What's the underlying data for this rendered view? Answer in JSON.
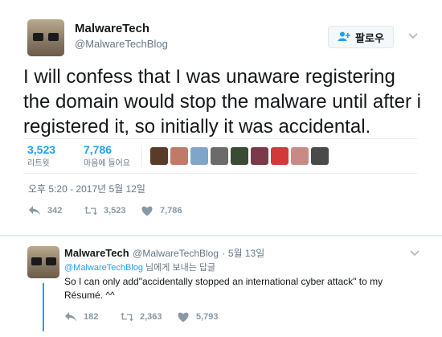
{
  "tweet": {
    "author_name": "MalwareTech",
    "author_handle": "@MalwareTechBlog",
    "follow_label": "팔로우",
    "text": "I will confess that I was unaware registering the domain would stop the malware until after i registered it, so initially it was accidental.",
    "retweets_count": "3,523",
    "retweets_label": "리트윗",
    "likes_count": "7,786",
    "likes_label": "마음에 들어요",
    "timestamp": "오후 5:20 - 2017년 5월 12일",
    "actions": {
      "reply": "342",
      "retweet": "3,523",
      "like": "7,786"
    }
  },
  "reply": {
    "author_name": "MalwareTech",
    "author_handle": "@MalwareTechBlog",
    "date": "· 5월 13일",
    "replying_to_handle": "@MalwareTechBlog",
    "replying_to_suffix": " 님에게 보내는 답글",
    "text": "So I can only add\"accidentally stopped an international cyber attack\" to my Résumé. ^^",
    "actions": {
      "reply": "182",
      "retweet": "2,363",
      "like": "5,793"
    }
  },
  "colors": {
    "accent": "#1da1f2",
    "muted": "#657786",
    "icon": "#8899a6",
    "divider": "#e6ecf0"
  },
  "likers": [
    "#5a3b2a",
    "#c07a6a",
    "#7fa6c9",
    "#6b6b6b",
    "#3b4a35",
    "#7b3a4a",
    "#d23a3a",
    "#c98a86",
    "#4a4a4a"
  ]
}
